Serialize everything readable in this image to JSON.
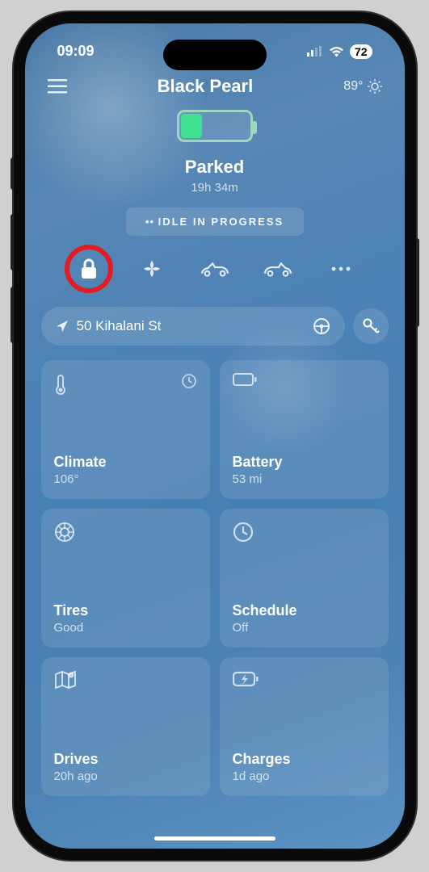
{
  "statusBar": {
    "time": "09:09",
    "batteryPercent": "72"
  },
  "header": {
    "carName": "Black Pearl",
    "tempLabel": "89°"
  },
  "state": {
    "label": "Parked",
    "duration": "19h 34m",
    "idleLabel": "IDLE IN PROGRESS"
  },
  "location": {
    "address": "50 Kihalani St"
  },
  "tiles": {
    "climate": {
      "label": "Climate",
      "value": "106°"
    },
    "battery": {
      "label": "Battery",
      "value": "53 mi"
    },
    "tires": {
      "label": "Tires",
      "value": "Good"
    },
    "schedule": {
      "label": "Schedule",
      "value": "Off"
    },
    "drives": {
      "label": "Drives",
      "value": "20h ago"
    },
    "charges": {
      "label": "Charges",
      "value": "1d ago"
    }
  }
}
